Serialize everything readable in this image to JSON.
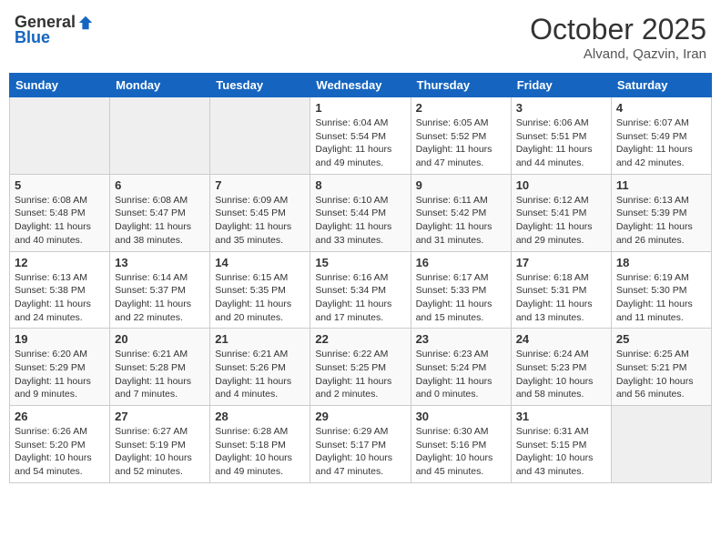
{
  "header": {
    "logo_general": "General",
    "logo_blue": "Blue",
    "month": "October 2025",
    "location": "Alvand, Qazvin, Iran"
  },
  "weekdays": [
    "Sunday",
    "Monday",
    "Tuesday",
    "Wednesday",
    "Thursday",
    "Friday",
    "Saturday"
  ],
  "weeks": [
    [
      {
        "day": "",
        "empty": true
      },
      {
        "day": "",
        "empty": true
      },
      {
        "day": "",
        "empty": true
      },
      {
        "day": "1",
        "sunrise": "Sunrise: 6:04 AM",
        "sunset": "Sunset: 5:54 PM",
        "daylight": "Daylight: 11 hours and 49 minutes."
      },
      {
        "day": "2",
        "sunrise": "Sunrise: 6:05 AM",
        "sunset": "Sunset: 5:52 PM",
        "daylight": "Daylight: 11 hours and 47 minutes."
      },
      {
        "day": "3",
        "sunrise": "Sunrise: 6:06 AM",
        "sunset": "Sunset: 5:51 PM",
        "daylight": "Daylight: 11 hours and 44 minutes."
      },
      {
        "day": "4",
        "sunrise": "Sunrise: 6:07 AM",
        "sunset": "Sunset: 5:49 PM",
        "daylight": "Daylight: 11 hours and 42 minutes."
      }
    ],
    [
      {
        "day": "5",
        "sunrise": "Sunrise: 6:08 AM",
        "sunset": "Sunset: 5:48 PM",
        "daylight": "Daylight: 11 hours and 40 minutes."
      },
      {
        "day": "6",
        "sunrise": "Sunrise: 6:08 AM",
        "sunset": "Sunset: 5:47 PM",
        "daylight": "Daylight: 11 hours and 38 minutes."
      },
      {
        "day": "7",
        "sunrise": "Sunrise: 6:09 AM",
        "sunset": "Sunset: 5:45 PM",
        "daylight": "Daylight: 11 hours and 35 minutes."
      },
      {
        "day": "8",
        "sunrise": "Sunrise: 6:10 AM",
        "sunset": "Sunset: 5:44 PM",
        "daylight": "Daylight: 11 hours and 33 minutes."
      },
      {
        "day": "9",
        "sunrise": "Sunrise: 6:11 AM",
        "sunset": "Sunset: 5:42 PM",
        "daylight": "Daylight: 11 hours and 31 minutes."
      },
      {
        "day": "10",
        "sunrise": "Sunrise: 6:12 AM",
        "sunset": "Sunset: 5:41 PM",
        "daylight": "Daylight: 11 hours and 29 minutes."
      },
      {
        "day": "11",
        "sunrise": "Sunrise: 6:13 AM",
        "sunset": "Sunset: 5:39 PM",
        "daylight": "Daylight: 11 hours and 26 minutes."
      }
    ],
    [
      {
        "day": "12",
        "sunrise": "Sunrise: 6:13 AM",
        "sunset": "Sunset: 5:38 PM",
        "daylight": "Daylight: 11 hours and 24 minutes."
      },
      {
        "day": "13",
        "sunrise": "Sunrise: 6:14 AM",
        "sunset": "Sunset: 5:37 PM",
        "daylight": "Daylight: 11 hours and 22 minutes."
      },
      {
        "day": "14",
        "sunrise": "Sunrise: 6:15 AM",
        "sunset": "Sunset: 5:35 PM",
        "daylight": "Daylight: 11 hours and 20 minutes."
      },
      {
        "day": "15",
        "sunrise": "Sunrise: 6:16 AM",
        "sunset": "Sunset: 5:34 PM",
        "daylight": "Daylight: 11 hours and 17 minutes."
      },
      {
        "day": "16",
        "sunrise": "Sunrise: 6:17 AM",
        "sunset": "Sunset: 5:33 PM",
        "daylight": "Daylight: 11 hours and 15 minutes."
      },
      {
        "day": "17",
        "sunrise": "Sunrise: 6:18 AM",
        "sunset": "Sunset: 5:31 PM",
        "daylight": "Daylight: 11 hours and 13 minutes."
      },
      {
        "day": "18",
        "sunrise": "Sunrise: 6:19 AM",
        "sunset": "Sunset: 5:30 PM",
        "daylight": "Daylight: 11 hours and 11 minutes."
      }
    ],
    [
      {
        "day": "19",
        "sunrise": "Sunrise: 6:20 AM",
        "sunset": "Sunset: 5:29 PM",
        "daylight": "Daylight: 11 hours and 9 minutes."
      },
      {
        "day": "20",
        "sunrise": "Sunrise: 6:21 AM",
        "sunset": "Sunset: 5:28 PM",
        "daylight": "Daylight: 11 hours and 7 minutes."
      },
      {
        "day": "21",
        "sunrise": "Sunrise: 6:21 AM",
        "sunset": "Sunset: 5:26 PM",
        "daylight": "Daylight: 11 hours and 4 minutes."
      },
      {
        "day": "22",
        "sunrise": "Sunrise: 6:22 AM",
        "sunset": "Sunset: 5:25 PM",
        "daylight": "Daylight: 11 hours and 2 minutes."
      },
      {
        "day": "23",
        "sunrise": "Sunrise: 6:23 AM",
        "sunset": "Sunset: 5:24 PM",
        "daylight": "Daylight: 11 hours and 0 minutes."
      },
      {
        "day": "24",
        "sunrise": "Sunrise: 6:24 AM",
        "sunset": "Sunset: 5:23 PM",
        "daylight": "Daylight: 10 hours and 58 minutes."
      },
      {
        "day": "25",
        "sunrise": "Sunrise: 6:25 AM",
        "sunset": "Sunset: 5:21 PM",
        "daylight": "Daylight: 10 hours and 56 minutes."
      }
    ],
    [
      {
        "day": "26",
        "sunrise": "Sunrise: 6:26 AM",
        "sunset": "Sunset: 5:20 PM",
        "daylight": "Daylight: 10 hours and 54 minutes."
      },
      {
        "day": "27",
        "sunrise": "Sunrise: 6:27 AM",
        "sunset": "Sunset: 5:19 PM",
        "daylight": "Daylight: 10 hours and 52 minutes."
      },
      {
        "day": "28",
        "sunrise": "Sunrise: 6:28 AM",
        "sunset": "Sunset: 5:18 PM",
        "daylight": "Daylight: 10 hours and 49 minutes."
      },
      {
        "day": "29",
        "sunrise": "Sunrise: 6:29 AM",
        "sunset": "Sunset: 5:17 PM",
        "daylight": "Daylight: 10 hours and 47 minutes."
      },
      {
        "day": "30",
        "sunrise": "Sunrise: 6:30 AM",
        "sunset": "Sunset: 5:16 PM",
        "daylight": "Daylight: 10 hours and 45 minutes."
      },
      {
        "day": "31",
        "sunrise": "Sunrise: 6:31 AM",
        "sunset": "Sunset: 5:15 PM",
        "daylight": "Daylight: 10 hours and 43 minutes."
      },
      {
        "day": "",
        "empty": true
      }
    ]
  ]
}
